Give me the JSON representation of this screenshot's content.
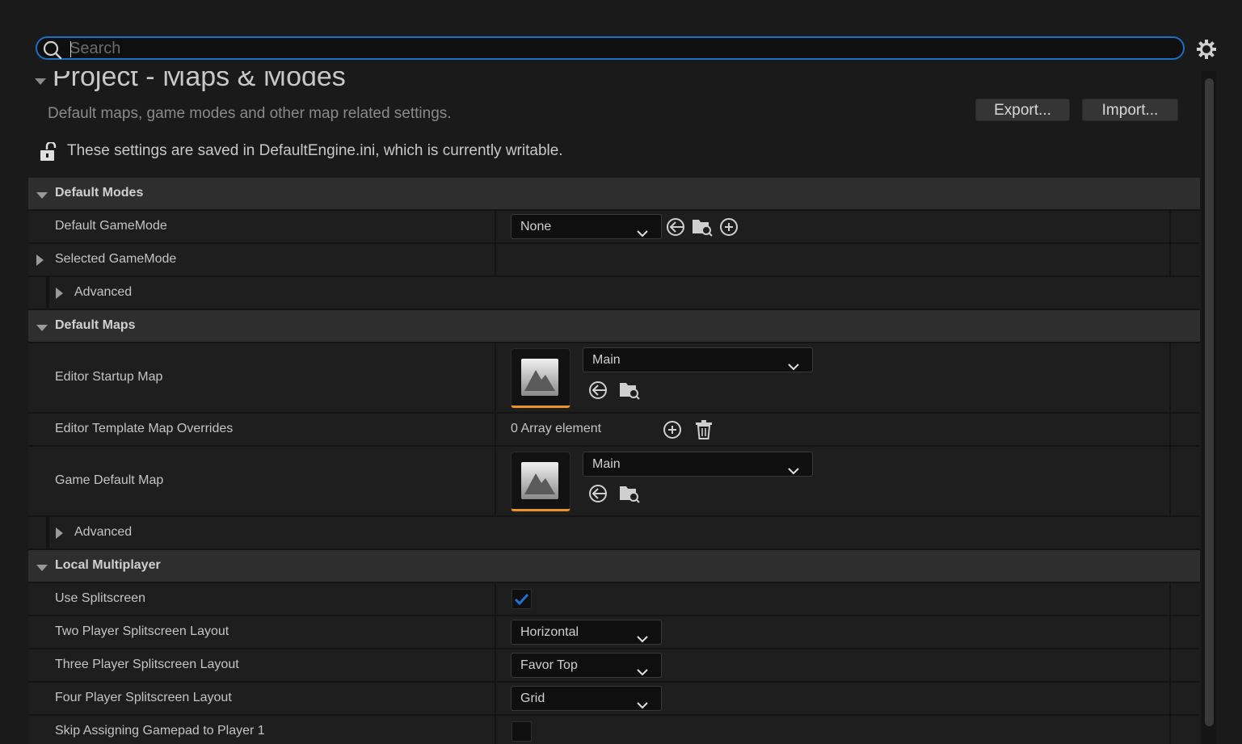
{
  "search": {
    "placeholder": "Search",
    "value": ""
  },
  "header": {
    "title": "Project - Maps & Modes",
    "subtitle": "Default maps, game modes and other map related settings.",
    "export_label": "Export...",
    "import_label": "Import...",
    "notice": "These settings are saved in DefaultEngine.ini, which is currently writable."
  },
  "sections": {
    "default_modes": {
      "label": "Default Modes",
      "default_gamemode": {
        "label": "Default GameMode",
        "value": "None"
      },
      "selected_gamemode": {
        "label": "Selected GameMode"
      },
      "advanced": {
        "label": "Advanced"
      }
    },
    "default_maps": {
      "label": "Default Maps",
      "editor_startup_map": {
        "label": "Editor Startup Map",
        "value": "Main"
      },
      "editor_template_overrides": {
        "label": "Editor Template Map Overrides",
        "value": "0 Array element"
      },
      "game_default_map": {
        "label": "Game Default Map",
        "value": "Main"
      },
      "advanced": {
        "label": "Advanced"
      }
    },
    "local_multiplayer": {
      "label": "Local Multiplayer",
      "use_splitscreen": {
        "label": "Use Splitscreen",
        "checked": true
      },
      "two_player": {
        "label": "Two Player Splitscreen Layout",
        "value": "Horizontal"
      },
      "three_player": {
        "label": "Three Player Splitscreen Layout",
        "value": "Favor Top"
      },
      "four_player": {
        "label": "Four Player Splitscreen Layout",
        "value": "Grid"
      },
      "skip_gamepad": {
        "label": "Skip Assigning Gamepad to Player 1",
        "checked": false
      }
    }
  },
  "colors": {
    "accent": "#1b6fc4",
    "thumbnail_underline": "#e8961c",
    "checkmark": "#1e74d6"
  }
}
